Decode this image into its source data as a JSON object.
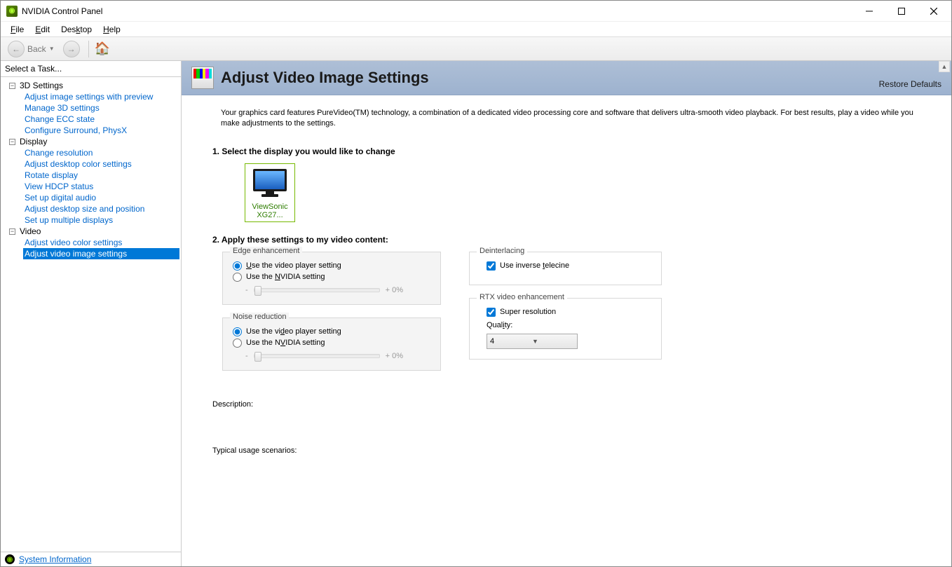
{
  "window": {
    "title": "NVIDIA Control Panel"
  },
  "menu": {
    "file": "File",
    "edit": "Edit",
    "desktop": "Desktop",
    "help": "Help"
  },
  "toolbar": {
    "back": "Back"
  },
  "sidebar": {
    "header": "Select a Task...",
    "groups": [
      {
        "label": "3D Settings",
        "items": [
          "Adjust image settings with preview",
          "Manage 3D settings",
          "Change ECC state",
          "Configure Surround, PhysX"
        ]
      },
      {
        "label": "Display",
        "items": [
          "Change resolution",
          "Adjust desktop color settings",
          "Rotate display",
          "View HDCP status",
          "Set up digital audio",
          "Adjust desktop size and position",
          "Set up multiple displays"
        ]
      },
      {
        "label": "Video",
        "items": [
          "Adjust video color settings",
          "Adjust video image settings"
        ]
      }
    ],
    "footer": "System Information"
  },
  "page": {
    "title": "Adjust Video Image Settings",
    "restore": "Restore Defaults",
    "intro": "Your graphics card features PureVideo(TM) technology, a combination of a dedicated video processing core and software that delivers ultra-smooth video playback. For best results, play a video while you make adjustments to the settings.",
    "step1": "1. Select the display you would like to change",
    "display_name": "ViewSonic XG27...",
    "step2": "2. Apply these settings to my video content:",
    "edge": {
      "legend": "Edge enhancement",
      "opt1": "Use the video player setting",
      "opt2": "Use the NVIDIA setting",
      "value": "+ 0%"
    },
    "noise": {
      "legend": "Noise reduction",
      "opt1": "Use the video player setting",
      "opt2": "Use the NVIDIA setting",
      "value": "+ 0%"
    },
    "deint": {
      "legend": "Deinterlacing",
      "opt1": "Use inverse telecine"
    },
    "rtx": {
      "legend": "RTX video enhancement",
      "opt1": "Super resolution",
      "quality_label": "Quality:",
      "quality_value": "4"
    },
    "description": "Description:",
    "scenarios": "Typical usage scenarios:"
  }
}
